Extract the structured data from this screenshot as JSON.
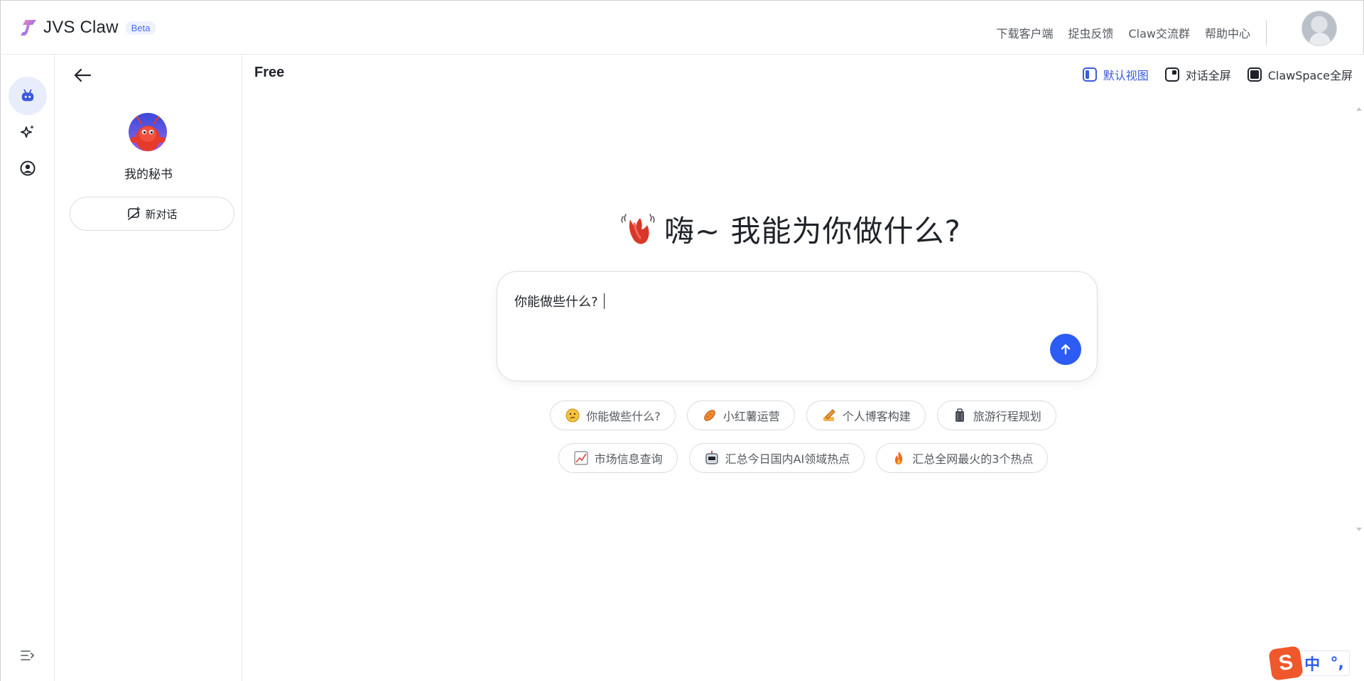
{
  "app": {
    "name": "JVS Claw",
    "badge": "Beta"
  },
  "header": {
    "links": [
      "下载客户端",
      "捉虫反馈",
      "Claw交流群",
      "帮助中心"
    ]
  },
  "rail": {
    "items": [
      "robot-icon",
      "sparkle-icon",
      "user-circle-icon"
    ],
    "collapse_icon": "collapse-menu-icon"
  },
  "sidebar": {
    "agent_name": "我的秘书",
    "new_chat_label": "新对话"
  },
  "main": {
    "plan": "Free",
    "views": [
      {
        "label": "默认视图",
        "active": true
      },
      {
        "label": "对话全屏",
        "active": false
      },
      {
        "label": "ClawSpace全屏",
        "active": false
      }
    ],
    "greeting": "嗨~ 我能为你做什么?",
    "composer_value": "你能做些什么?",
    "chips_row1": [
      {
        "label": "你能做些什么?",
        "icon": "thinking-face-icon"
      },
      {
        "label": "小红薯运营",
        "icon": "sweet-potato-icon"
      },
      {
        "label": "个人博客构建",
        "icon": "writing-hand-icon"
      },
      {
        "label": "旅游行程规划",
        "icon": "luggage-icon"
      }
    ],
    "chips_row2": [
      {
        "label": "市场信息查询",
        "icon": "chart-up-icon"
      },
      {
        "label": "汇总今日国内AI领域热点",
        "icon": "robot-face-icon"
      },
      {
        "label": "汇总全网最火的3个热点",
        "icon": "fire-icon"
      }
    ]
  },
  "ime": {
    "logo": "S",
    "mode": "中",
    "punct": "°,"
  },
  "colors": {
    "accent": "#2c5cf3",
    "active_view": "#3b5bdb",
    "rail_active_bg": "#e8edfb"
  }
}
